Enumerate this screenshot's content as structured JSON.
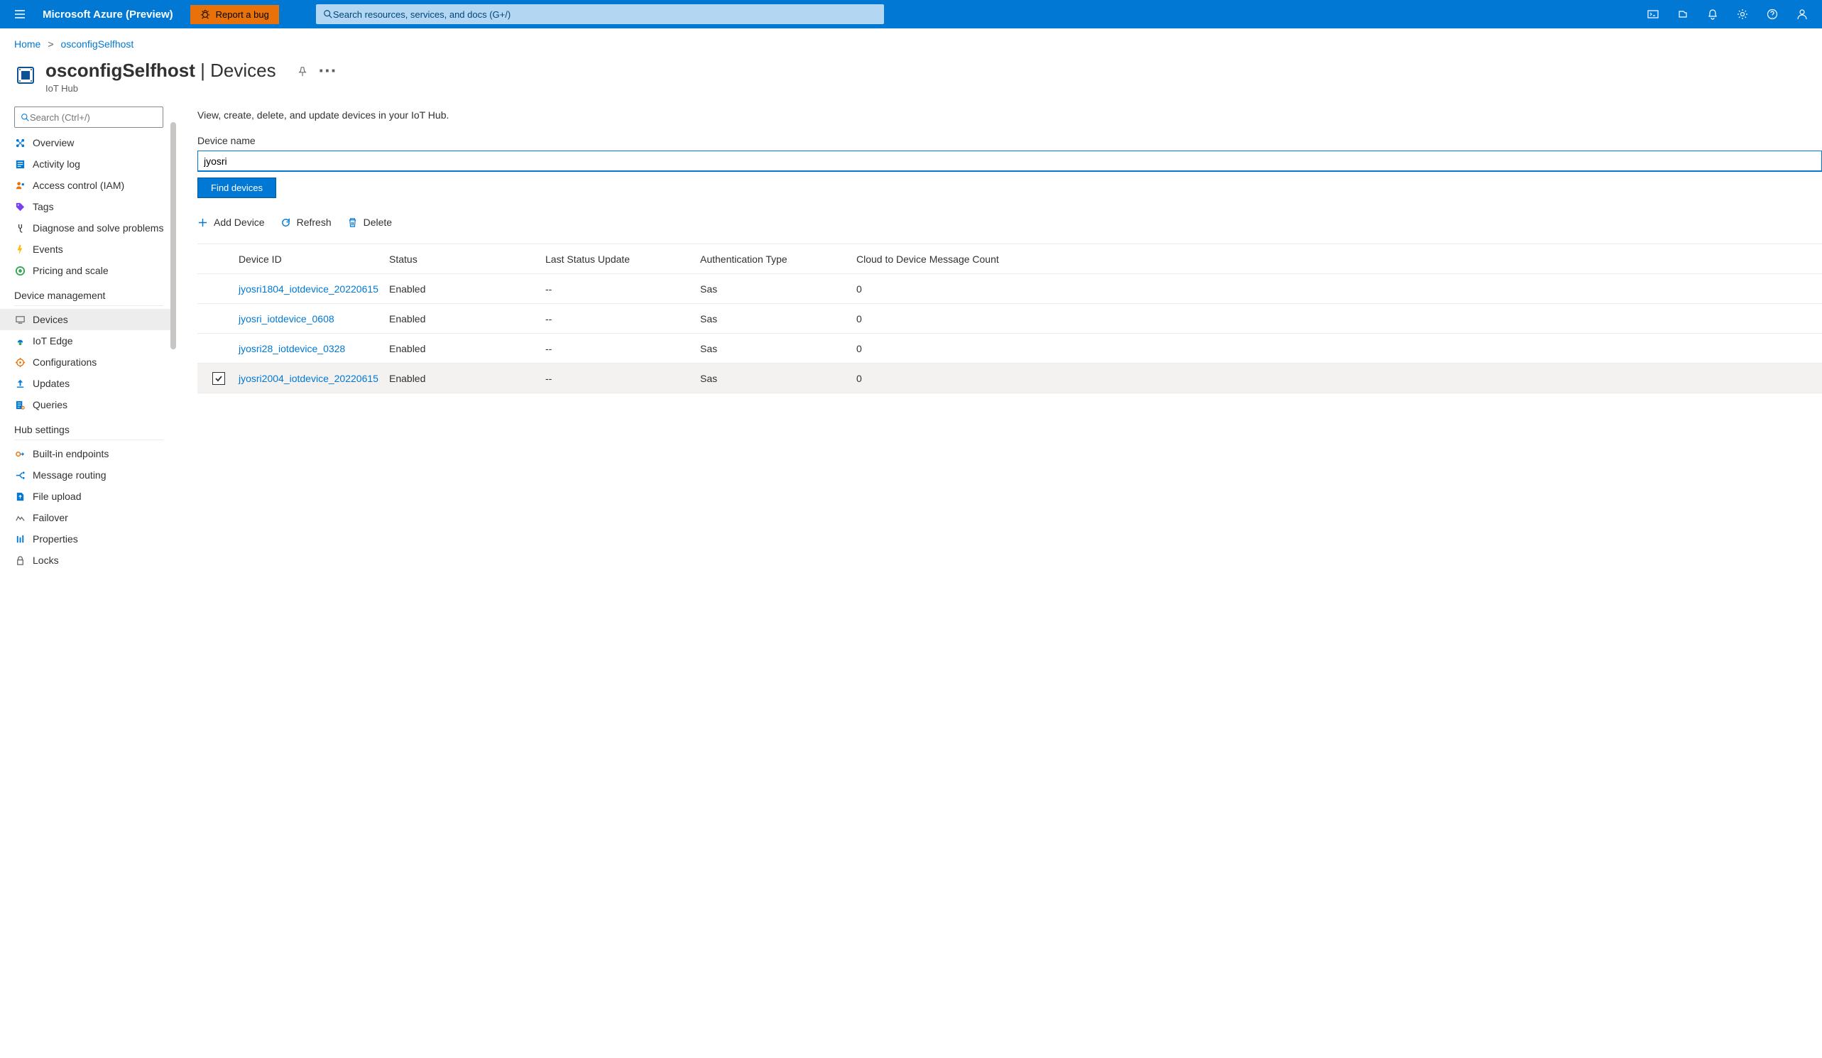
{
  "header": {
    "brand": "Microsoft Azure (Preview)",
    "report_bug": "Report a bug",
    "search_placeholder": "Search resources, services, and docs (G+/)"
  },
  "breadcrumb": {
    "home": "Home",
    "resource": "osconfigSelfhost"
  },
  "page": {
    "title_resource": "osconfigSelfhost",
    "title_section": "Devices",
    "subtitle": "IoT Hub"
  },
  "sidebar": {
    "search_placeholder": "Search (Ctrl+/)",
    "items_top": [
      {
        "label": "Overview"
      },
      {
        "label": "Activity log"
      },
      {
        "label": "Access control (IAM)"
      },
      {
        "label": "Tags"
      },
      {
        "label": "Diagnose and solve problems"
      },
      {
        "label": "Events"
      },
      {
        "label": "Pricing and scale"
      }
    ],
    "section_device": "Device management",
    "items_device": [
      {
        "label": "Devices"
      },
      {
        "label": "IoT Edge"
      },
      {
        "label": "Configurations"
      },
      {
        "label": "Updates"
      },
      {
        "label": "Queries"
      }
    ],
    "section_hub": "Hub settings",
    "items_hub": [
      {
        "label": "Built-in endpoints"
      },
      {
        "label": "Message routing"
      },
      {
        "label": "File upload"
      },
      {
        "label": "Failover"
      },
      {
        "label": "Properties"
      },
      {
        "label": "Locks"
      }
    ]
  },
  "main": {
    "description": "View, create, delete, and update devices in your IoT Hub.",
    "device_name_label": "Device name",
    "device_name_value": "jyosri",
    "find_devices": "Find devices",
    "add_device": "Add Device",
    "refresh": "Refresh",
    "delete": "Delete",
    "columns": {
      "id": "Device ID",
      "status": "Status",
      "update": "Last Status Update",
      "auth": "Authentication Type",
      "c2d": "Cloud to Device Message Count"
    },
    "rows": [
      {
        "id": "jyosri1804_iotdevice_20220615",
        "status": "Enabled",
        "update": "--",
        "auth": "Sas",
        "c2d": "0",
        "checked": false
      },
      {
        "id": "jyosri_iotdevice_0608",
        "status": "Enabled",
        "update": "--",
        "auth": "Sas",
        "c2d": "0",
        "checked": false
      },
      {
        "id": "jyosri28_iotdevice_0328",
        "status": "Enabled",
        "update": "--",
        "auth": "Sas",
        "c2d": "0",
        "checked": false
      },
      {
        "id": "jyosri2004_iotdevice_20220615",
        "status": "Enabled",
        "update": "--",
        "auth": "Sas",
        "c2d": "0",
        "checked": true
      }
    ]
  }
}
